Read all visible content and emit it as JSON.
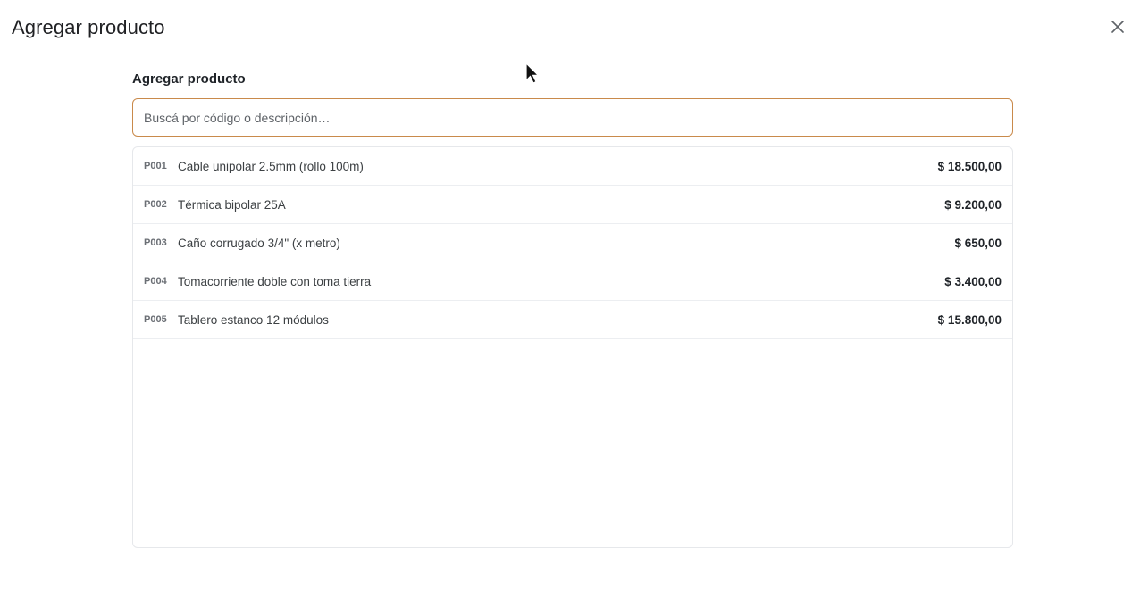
{
  "dialog": {
    "title": "Agregar producto",
    "close_icon": "close-icon"
  },
  "form": {
    "section_title": "Agregar producto",
    "search_placeholder": "Buscá por código o descripción…",
    "search_value": ""
  },
  "products": [
    {
      "code": "P001",
      "description": "Cable unipolar 2.5mm (rollo 100m)",
      "price": "$ 18.500,00"
    },
    {
      "code": "P002",
      "description": "Térmica bipolar 25A",
      "price": "$ 9.200,00"
    },
    {
      "code": "P003",
      "description": "Caño corrugado 3/4\" (x metro)",
      "price": "$ 650,00"
    },
    {
      "code": "P004",
      "description": "Tomacorriente doble con toma tierra",
      "price": "$ 3.400,00"
    },
    {
      "code": "P005",
      "description": "Tablero estanco 12 módulos",
      "price": "$ 15.800,00"
    }
  ],
  "colors": {
    "input_border": "#c98a4b",
    "text": "#202124"
  }
}
